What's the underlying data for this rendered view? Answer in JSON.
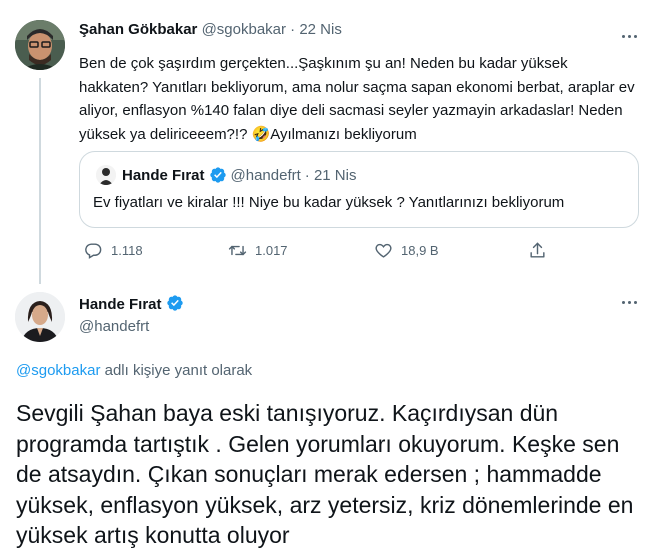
{
  "tweet": {
    "author_name": "Şahan Gökbakar",
    "author_handle": "@sgokbakar",
    "time": "· 22 Nis",
    "text": "Ben de çok şaşırdım gerçekten...Şaşkınım şu an! Neden bu kadar yüksek hakkaten? Yanıtları bekliyorum, ama nolur saçma sapan ekonomi berbat, araplar ev aliyor, enflasyon %140 falan diye deli sacmasi seyler yazmayin arkadaslar! Neden yüksek ya deliriceeem?!? 🤣Ayılmanızı bekliyorum",
    "quote": {
      "author_name": "Hande Fırat",
      "author_handle": "@handefrt",
      "time": "· 21 Nis",
      "text": "Ev fiyatları ve kiralar !!! Niye bu kadar yüksek ? Yanıtlarınızı bekliyorum"
    },
    "actions": {
      "replies": "1.118",
      "retweets": "1.017",
      "likes": "18,9 B"
    }
  },
  "reply": {
    "author_name": "Hande Fırat",
    "author_handle": "@handefrt",
    "context_mention": "@sgokbakar",
    "context_suffix": " adlı kişiye yanıt olarak",
    "text": "Sevgili Şahan baya eski tanışıyoruz. Kaçırdıysan dün programda tartıştık . Gelen yorumları okuyorum. Keşke sen de atsaydın. Çıkan sonuçları merak edersen ; hammadde yüksek, enflasyon yüksek, arz yetersiz, kriz dönemlerinde en yüksek artış konutta oluyor"
  },
  "colors": {
    "verified": "#1d9bf0",
    "mention": "#1d9bf0",
    "secondary_text": "#536471"
  },
  "icons": [
    "more-icon",
    "verified-icon",
    "reply-icon",
    "retweet-icon",
    "like-icon",
    "share-icon"
  ]
}
